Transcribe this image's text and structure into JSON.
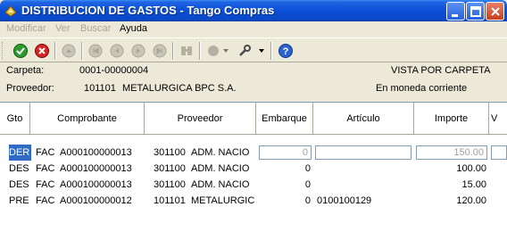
{
  "window": {
    "title": "DISTRIBUCION DE GASTOS - Tango Compras"
  },
  "menu": [
    {
      "label": "Modificar",
      "enabled": false
    },
    {
      "label": "Ver",
      "enabled": false
    },
    {
      "label": "Buscar",
      "enabled": false
    },
    {
      "label": "Ayuda",
      "enabled": true
    }
  ],
  "toolbar": {
    "icons": [
      "accept-icon",
      "cancel-icon",
      "up-icon",
      "first-icon",
      "previous-icon",
      "next-icon",
      "last-icon",
      "calculator-icon",
      "gear-icon",
      "tools-icon",
      "help-icon"
    ]
  },
  "header": {
    "carpeta_label": "Carpeta:",
    "carpeta_value": "0001-00000004",
    "vista": "VISTA POR CARPETA",
    "proveedor_label": "Proveedor:",
    "proveedor_code": "101101",
    "proveedor_name": "METALURGICA BPC S.A.",
    "moneda": "En moneda corriente"
  },
  "grid": {
    "columns": [
      "Gto",
      "Comprobante",
      "Proveedor",
      "Embarque",
      "Artículo",
      "Importe",
      "V"
    ],
    "rows": [
      {
        "gto": "DER",
        "tipo": "FAC",
        "comprobante": "A000100000013",
        "prov_code": "301100",
        "prov_name": "ADM. NACIO",
        "embarque": "0",
        "articulo": "",
        "importe": "150.00"
      },
      {
        "gto": "DES",
        "tipo": "FAC",
        "comprobante": "A000100000013",
        "prov_code": "301100",
        "prov_name": "ADM. NACIO",
        "embarque": "0",
        "articulo": "",
        "importe": "100.00"
      },
      {
        "gto": "DES",
        "tipo": "FAC",
        "comprobante": "A000100000013",
        "prov_code": "301100",
        "prov_name": "ADM. NACIO",
        "embarque": "0",
        "articulo": "",
        "importe": "15.00"
      },
      {
        "gto": "PRE",
        "tipo": "FAC",
        "comprobante": "A000100000012",
        "prov_code": "101101",
        "prov_name": "METALURGIC",
        "embarque": "0",
        "articulo": "0100100129",
        "importe": "120.00"
      }
    ]
  }
}
